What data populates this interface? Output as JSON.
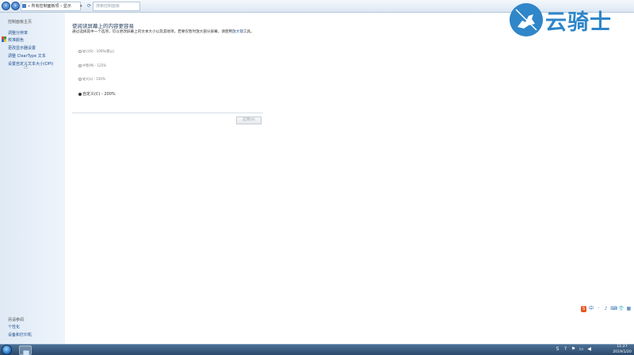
{
  "addressbar": {
    "breadcrumb": "« 所有控制面板项 › 显示",
    "dropdown_arrow": "▾",
    "refresh_glyph": "⟳",
    "search_placeholder": "搜索控制面板"
  },
  "sidebar": {
    "home": "控制面板主页",
    "items": [
      {
        "label": "调整分辨率"
      },
      {
        "label": "校准颜色"
      },
      {
        "label": "更改显示器设置"
      },
      {
        "label": "调整 ClearType 文本"
      },
      {
        "label": "设置自定义文本大小(DPI)"
      }
    ],
    "see_also_heading": "另请参阅",
    "see_also": [
      {
        "label": "个性化"
      },
      {
        "label": "设备和打印机"
      }
    ]
  },
  "main": {
    "title": "使阅读屏幕上的内容更容易",
    "description": "通过选择其中一个选项，可以更改屏幕上的文本大小以及其他项。若要仅暂时放大部分屏幕，请使用",
    "description_link": "放大镜",
    "description_link_suffix": "工具。",
    "options": [
      {
        "label": "较小(S) - 100%(默认)",
        "selected": false
      },
      {
        "label": "中等(M) - 125%",
        "selected": false
      },
      {
        "label": "较大(L) - 150%",
        "selected": false
      },
      {
        "label": "自定义(C) - 200%",
        "selected": true
      }
    ],
    "apply_label": "应用(A)"
  },
  "watermark": {
    "text": "云骑士"
  },
  "ime": {
    "logo": "S",
    "mode": "中",
    "items": [
      "·",
      "♪",
      "⌨",
      "👕",
      "▦"
    ]
  },
  "tray": {
    "icons": [
      "S",
      "?",
      "⚑",
      "▭",
      "◀"
    ],
    "time": "11:27",
    "date": "2019/1/20"
  },
  "colors": {
    "accent": "#2f86c9",
    "link": "#1e4e8c",
    "taskbar": "#2b4a6d"
  }
}
